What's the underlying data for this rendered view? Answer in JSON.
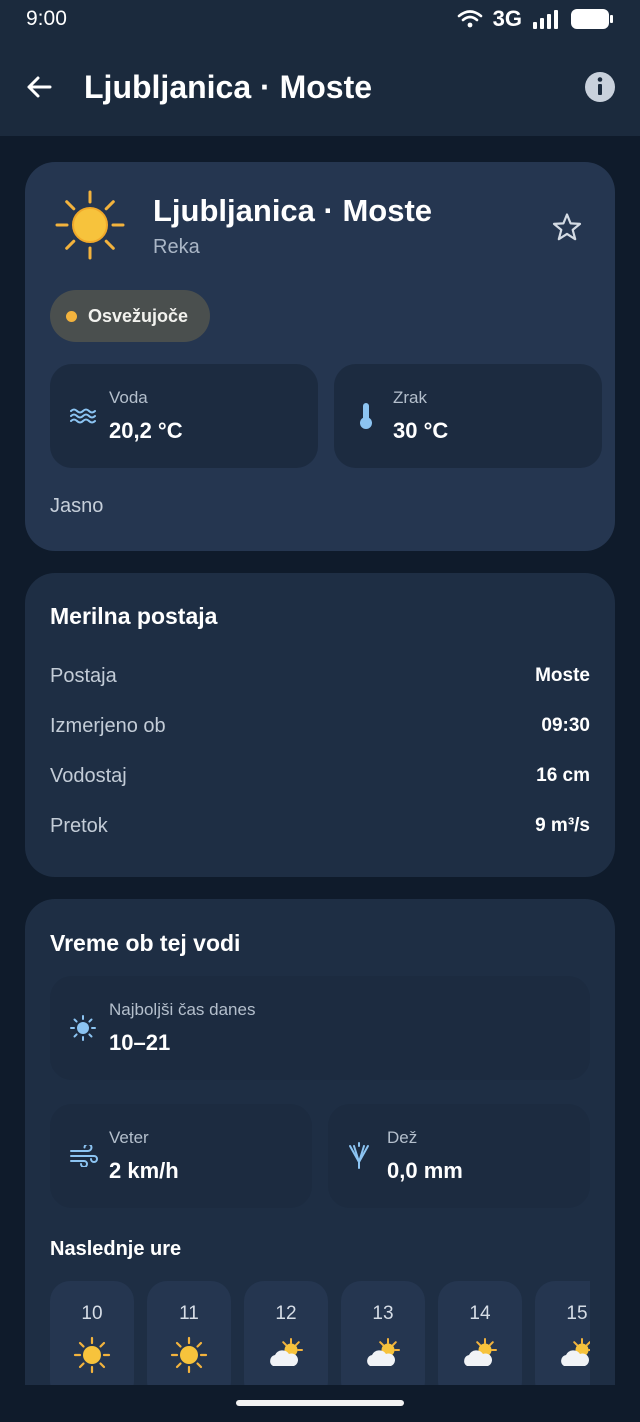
{
  "status_bar": {
    "time": "9:00",
    "network": "3G"
  },
  "app_bar": {
    "title": "Ljubljanica · Moste"
  },
  "hero": {
    "title": "Ljubljanica · Moste",
    "subtitle": "Reka",
    "chip": "Osvežujoče",
    "water": {
      "label": "Voda",
      "value": "20,2 °C"
    },
    "air": {
      "label": "Zrak",
      "value": "30 °C"
    },
    "description": "Jasno"
  },
  "station": {
    "heading": "Merilna postaja",
    "rows": [
      {
        "label": "Postaja",
        "value": "Moste"
      },
      {
        "label": "Izmerjeno ob",
        "value": "09:30"
      },
      {
        "label": "Vodostaj",
        "value": "16 cm"
      },
      {
        "label": "Pretok",
        "value": "9 m³/s"
      }
    ]
  },
  "weather": {
    "heading": "Vreme ob tej vodi",
    "best_time": {
      "label": "Najboljši čas danes",
      "value": "10–21"
    },
    "wind": {
      "label": "Veter",
      "value": "2 km/h"
    },
    "rain": {
      "label": "Dež",
      "value": "0,0 mm"
    },
    "hours_heading": "Naslednje ure",
    "hours": [
      {
        "hour": "10",
        "icon": "sun-icon"
      },
      {
        "hour": "11",
        "icon": "sun-icon"
      },
      {
        "hour": "12",
        "icon": "partly-cloudy-icon"
      },
      {
        "hour": "13",
        "icon": "partly-cloudy-icon"
      },
      {
        "hour": "14",
        "icon": "partly-cloudy-icon"
      },
      {
        "hour": "15",
        "icon": "partly-cloudy-icon"
      }
    ]
  },
  "colors": {
    "background": "#0f1b2b",
    "app_bar": "#1b2a3d",
    "hero_card": "#253650",
    "card": "#1e2e44",
    "accent_sun": "#f3b33d",
    "icon_blue": "#8cc4f2"
  }
}
